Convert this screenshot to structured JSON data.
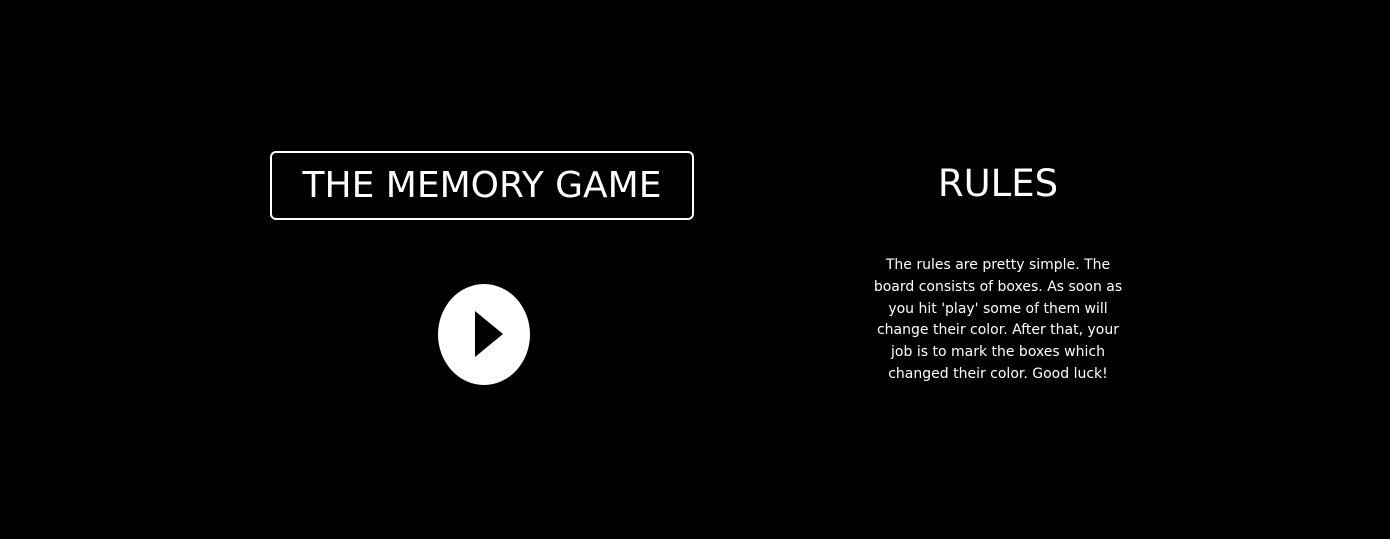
{
  "game": {
    "title": "THE MEMORY GAME",
    "play_icon": "play-icon"
  },
  "rules": {
    "heading": "RULES",
    "body": "The rules are pretty simple. The board consists of boxes. As soon as you hit 'play' some of them will change their color. After that, your job is to mark the boxes which changed their color. Good luck!"
  },
  "colors": {
    "background": "#000000",
    "foreground": "#ffffff"
  }
}
